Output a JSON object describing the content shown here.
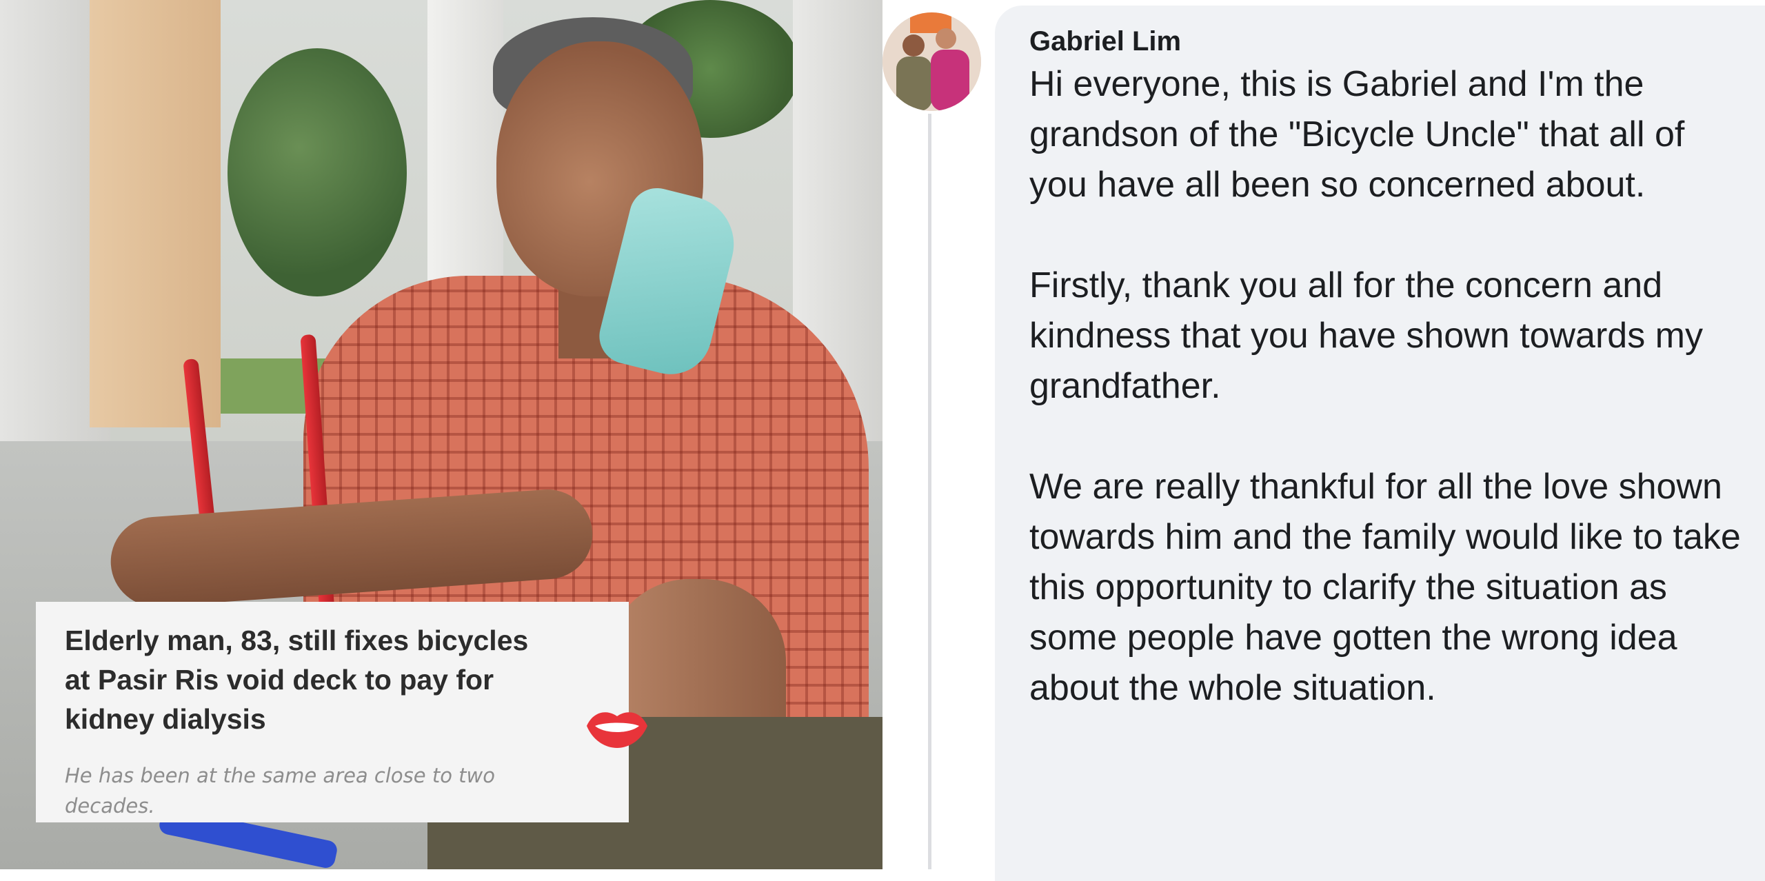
{
  "news_card": {
    "headline": "Elderly man, 83, still fixes bicycles at Pasir Ris void deck to pay for kidney dialysis",
    "subtitle": "He has been at the same area close to two decades.",
    "logo_icon": "red-lips-icon",
    "brand_color": "#e8343a"
  },
  "comment": {
    "author": "Gabriel Lim",
    "paragraphs": [
      "Hi everyone, this is Gabriel and I'm the grandson of the \"Bicycle Uncle\" that all of you have all been so concerned about.",
      "Firstly, thank you all for the concern and kindness that you have shown towards my grandfather.",
      "We are really thankful for all the love shown towards him and the family would like to take this opportunity to clarify the situation as some people have gotten the wrong idea about the whole situation."
    ],
    "bubble_color": "#f0f2f5",
    "text_color": "#1c1e21"
  }
}
